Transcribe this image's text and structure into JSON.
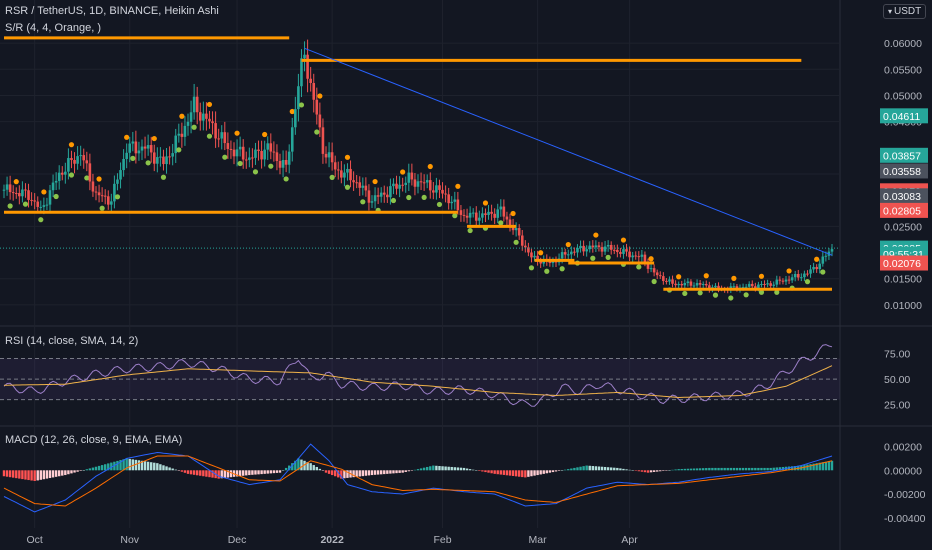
{
  "header": {
    "title": "RSR / TetherUS, 1D, BINANCE, Heikin Ashi",
    "indicator": "S/R (4, 4, Orange, )",
    "currency": "USDT"
  },
  "colors": {
    "background": "#131722",
    "grid": "#1e222d",
    "bull": "#26a69a",
    "bear": "#ef5350",
    "orange": "#ff9800",
    "green_dot": "#8bc34a",
    "trendline": "#2962ff",
    "rsi_line": "#9c7fc8",
    "rsi_ma": "#f0b34a",
    "macd_line": "#2962ff",
    "signal_line": "#ff6d00"
  },
  "chart_data": [
    {
      "type": "candlestick",
      "panel": "price",
      "ylim": [
        0.0075,
        0.0625
      ],
      "yticks": [
        "0.06000",
        "0.05500",
        "0.05000",
        "0.04500",
        "0.03500",
        "0.02500",
        "0.01500",
        "0.01000"
      ],
      "xticks": [
        "Oct",
        "Nov",
        "Dec",
        "2022",
        "Feb",
        "Mar",
        "Apr"
      ],
      "price_labels": [
        {
          "text": "0.04611",
          "value": 0.04611,
          "color": "#26a69a"
        },
        {
          "text": "0.03857",
          "value": 0.03857,
          "color": "#26a69a"
        },
        {
          "text": "0.03558",
          "value": 0.03558,
          "color": "#4c525e"
        },
        {
          "text": "0.03179",
          "value": 0.03179,
          "color": "#ef5350"
        },
        {
          "text": "0.03083",
          "value": 0.03083,
          "color": "#4c525e"
        },
        {
          "text": "0.02805",
          "value": 0.02805,
          "color": "#ef5350"
        },
        {
          "text": "0.02085",
          "value": 0.02085,
          "color": "#26a69a"
        },
        {
          "text": "09:55:31",
          "value": 0.0197,
          "color": "#26a69a"
        },
        {
          "text": "0.02076",
          "value": 0.018,
          "color": "#ef5350"
        }
      ],
      "sr_levels": [
        {
          "y": 0.061,
          "from": 0,
          "to": 93
        },
        {
          "y": 0.0567,
          "from": 97,
          "to": 260
        },
        {
          "y": 0.0277,
          "from": 0,
          "to": 148
        },
        {
          "y": 0.025,
          "from": 151,
          "to": 167
        },
        {
          "y": 0.0185,
          "from": 173,
          "to": 186
        },
        {
          "y": 0.018,
          "from": 184,
          "to": 212
        },
        {
          "y": 0.013,
          "from": 215,
          "to": 270
        }
      ],
      "trendline": [
        {
          "x": 98,
          "y": 0.059
        },
        {
          "x": 270,
          "y": 0.0195
        }
      ],
      "last_price": 0.02085,
      "series": [
        {
          "name": "Heikin Ashi",
          "ohlc_anchor": [
            {
              "x": 0,
              "y": 0.032
            },
            {
              "x": 8,
              "y": 0.031
            },
            {
              "x": 12,
              "y": 0.028
            },
            {
              "x": 18,
              "y": 0.035
            },
            {
              "x": 25,
              "y": 0.039
            },
            {
              "x": 30,
              "y": 0.031
            },
            {
              "x": 35,
              "y": 0.03
            },
            {
              "x": 40,
              "y": 0.04
            },
            {
              "x": 46,
              "y": 0.04
            },
            {
              "x": 52,
              "y": 0.037
            },
            {
              "x": 58,
              "y": 0.043
            },
            {
              "x": 62,
              "y": 0.048
            },
            {
              "x": 68,
              "y": 0.044
            },
            {
              "x": 73,
              "y": 0.04
            },
            {
              "x": 80,
              "y": 0.038
            },
            {
              "x": 86,
              "y": 0.04
            },
            {
              "x": 92,
              "y": 0.036
            },
            {
              "x": 96,
              "y": 0.052
            },
            {
              "x": 98,
              "y": 0.058
            },
            {
              "x": 101,
              "y": 0.049
            },
            {
              "x": 104,
              "y": 0.04
            },
            {
              "x": 108,
              "y": 0.036
            },
            {
              "x": 114,
              "y": 0.034
            },
            {
              "x": 120,
              "y": 0.03
            },
            {
              "x": 126,
              "y": 0.032
            },
            {
              "x": 132,
              "y": 0.034
            },
            {
              "x": 138,
              "y": 0.033
            },
            {
              "x": 144,
              "y": 0.031
            },
            {
              "x": 150,
              "y": 0.027
            },
            {
              "x": 156,
              "y": 0.027
            },
            {
              "x": 162,
              "y": 0.028
            },
            {
              "x": 168,
              "y": 0.023
            },
            {
              "x": 172,
              "y": 0.019
            },
            {
              "x": 178,
              "y": 0.018
            },
            {
              "x": 184,
              "y": 0.02
            },
            {
              "x": 190,
              "y": 0.021
            },
            {
              "x": 196,
              "y": 0.021
            },
            {
              "x": 202,
              "y": 0.02
            },
            {
              "x": 208,
              "y": 0.019
            },
            {
              "x": 212,
              "y": 0.016
            },
            {
              "x": 218,
              "y": 0.014
            },
            {
              "x": 226,
              "y": 0.014
            },
            {
              "x": 234,
              "y": 0.013
            },
            {
              "x": 242,
              "y": 0.0135
            },
            {
              "x": 250,
              "y": 0.014
            },
            {
              "x": 256,
              "y": 0.015
            },
            {
              "x": 262,
              "y": 0.016
            },
            {
              "x": 266,
              "y": 0.018
            },
            {
              "x": 270,
              "y": 0.0208
            }
          ]
        }
      ]
    },
    {
      "type": "line",
      "panel": "rsi",
      "title": "RSI (14, close, SMA, 14, 2)",
      "ylim": [
        15,
        90
      ],
      "yticks": [
        "75.00",
        "50.00",
        "25.00"
      ],
      "bands": [
        70,
        50,
        30
      ],
      "series": [
        {
          "name": "RSI",
          "x": [
            0,
            10,
            20,
            30,
            40,
            50,
            60,
            70,
            80,
            90,
            96,
            100,
            105,
            110,
            120,
            130,
            140,
            150,
            160,
            170,
            176,
            182,
            188,
            194,
            200,
            210,
            215,
            222,
            230,
            240,
            248,
            254,
            260,
            265,
            270
          ],
          "values": [
            43,
            38,
            48,
            55,
            60,
            62,
            66,
            60,
            50,
            48,
            72,
            50,
            55,
            45,
            42,
            44,
            38,
            40,
            35,
            25,
            30,
            42,
            38,
            45,
            40,
            33,
            30,
            31,
            33,
            35,
            42,
            55,
            67,
            75,
            85
          ]
        },
        {
          "name": "RSI-based MA",
          "x": [
            0,
            20,
            40,
            60,
            80,
            100,
            120,
            140,
            160,
            180,
            200,
            220,
            240,
            255,
            270
          ],
          "values": [
            44,
            45,
            54,
            60,
            58,
            56,
            47,
            43,
            37,
            34,
            37,
            32,
            34,
            43,
            63
          ]
        }
      ]
    },
    {
      "type": "bar",
      "panel": "macd",
      "title": "MACD (12, 26, close, 9, EMA, EMA)",
      "ylim": [
        -0.0046,
        0.0028
      ],
      "yticks": [
        "0.00200",
        "0.00000",
        "-0.00200",
        "-0.00400"
      ],
      "series": [
        {
          "name": "Histogram",
          "x": [
            0,
            10,
            20,
            30,
            40,
            50,
            60,
            70,
            80,
            90,
            96,
            100,
            105,
            110,
            120,
            130,
            140,
            150,
            160,
            170,
            180,
            190,
            200,
            210,
            220,
            230,
            240,
            250,
            260,
            270
          ],
          "values": [
            -0.0005,
            -0.0009,
            -0.0004,
            0.0003,
            0.001,
            0.0006,
            -0.0003,
            -0.0007,
            -0.0004,
            -0.0002,
            0.001,
            0.0006,
            -0.0002,
            -0.0007,
            -0.0004,
            -0.0002,
            0.0004,
            0.0002,
            -0.0003,
            -0.0006,
            -0.0001,
            0.0004,
            0.0002,
            -0.0002,
            0.0001,
            0.0002,
            0.0002,
            0.0002,
            0.0004,
            0.0008
          ]
        },
        {
          "name": "MACD",
          "x": [
            0,
            10,
            20,
            30,
            40,
            50,
            60,
            70,
            80,
            90,
            96,
            100,
            106,
            112,
            120,
            130,
            140,
            150,
            160,
            170,
            180,
            190,
            200,
            210,
            220,
            230,
            240,
            250,
            260,
            270
          ],
          "values": [
            -0.0022,
            -0.0035,
            -0.0025,
            -0.0005,
            0.001,
            0.0015,
            0.0012,
            -0.0005,
            -0.0012,
            -0.0008,
            0.001,
            0.0022,
            0.0008,
            -0.0012,
            -0.0018,
            -0.002,
            -0.0015,
            -0.0018,
            -0.002,
            -0.003,
            -0.0028,
            -0.0015,
            -0.001,
            -0.0012,
            -0.001,
            -0.0006,
            -0.0003,
            -0.0001,
            0.0004,
            0.0012
          ]
        },
        {
          "name": "Signal",
          "x": [
            0,
            10,
            20,
            30,
            40,
            50,
            60,
            70,
            80,
            90,
            100,
            110,
            120,
            130,
            140,
            150,
            160,
            170,
            180,
            190,
            200,
            210,
            220,
            230,
            240,
            250,
            260,
            270
          ],
          "values": [
            -0.0015,
            -0.0028,
            -0.003,
            -0.0015,
            0.0002,
            0.0012,
            0.0012,
            0.0002,
            -0.0008,
            -0.0009,
            0.0008,
            0.0001,
            -0.0012,
            -0.0017,
            -0.0016,
            -0.0017,
            -0.0018,
            -0.0025,
            -0.0027,
            -0.002,
            -0.0013,
            -0.0012,
            -0.0011,
            -0.0008,
            -0.0005,
            -0.0002,
            0.0002,
            0.0008
          ]
        }
      ]
    }
  ]
}
